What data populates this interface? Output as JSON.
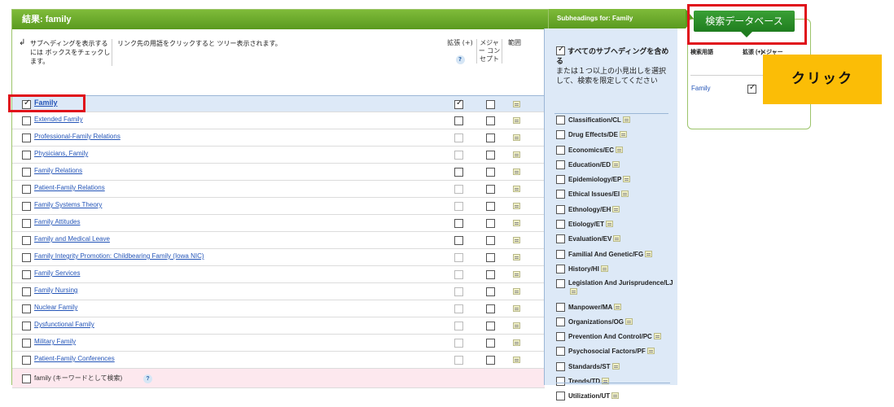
{
  "results": {
    "header": "結果: family",
    "instruction_col1": "サブヘディングを表示するには ボックスをチェックします。",
    "instruction_col2": "リンク先の用語をクリックすると ツリー表示されます。",
    "col_explode": "拡張 (+)",
    "col_major": "メジャー コンセプト",
    "col_scope": "範囲",
    "help_icon": "?",
    "rows": [
      {
        "label": "Family",
        "term_checked": true,
        "explode_checked": true,
        "major_checked": false,
        "explode_enabled": true
      },
      {
        "label": "Extended Family",
        "term_checked": false,
        "explode_checked": false,
        "major_checked": false,
        "explode_enabled": true
      },
      {
        "label": "Professional-Family Relations",
        "term_checked": false,
        "explode_checked": false,
        "major_checked": false,
        "explode_enabled": false
      },
      {
        "label": "Physicians, Family",
        "term_checked": false,
        "explode_checked": false,
        "major_checked": false,
        "explode_enabled": false
      },
      {
        "label": "Family Relations",
        "term_checked": false,
        "explode_checked": false,
        "major_checked": false,
        "explode_enabled": true
      },
      {
        "label": "Patient-Family Relations",
        "term_checked": false,
        "explode_checked": false,
        "major_checked": false,
        "explode_enabled": false
      },
      {
        "label": "Family Systems Theory",
        "term_checked": false,
        "explode_checked": false,
        "major_checked": false,
        "explode_enabled": false
      },
      {
        "label": "Family Attitudes",
        "term_checked": false,
        "explode_checked": false,
        "major_checked": false,
        "explode_enabled": true
      },
      {
        "label": "Family and Medical Leave",
        "term_checked": false,
        "explode_checked": false,
        "major_checked": false,
        "explode_enabled": true
      },
      {
        "label": "Family Integrity Promotion: Childbearing Family (Iowa NIC)",
        "term_checked": false,
        "explode_checked": false,
        "major_checked": false,
        "explode_enabled": false
      },
      {
        "label": "Family Services",
        "term_checked": false,
        "explode_checked": false,
        "major_checked": false,
        "explode_enabled": false
      },
      {
        "label": "Family Nursing",
        "term_checked": false,
        "explode_checked": false,
        "major_checked": false,
        "explode_enabled": false
      },
      {
        "label": "Nuclear Family",
        "term_checked": false,
        "explode_checked": false,
        "major_checked": false,
        "explode_enabled": false
      },
      {
        "label": "Dysfunctional Family",
        "term_checked": false,
        "explode_checked": false,
        "major_checked": false,
        "explode_enabled": false
      },
      {
        "label": "Military Family",
        "term_checked": false,
        "explode_checked": false,
        "major_checked": false,
        "explode_enabled": false
      },
      {
        "label": "Patient-Family Conferences",
        "term_checked": false,
        "explode_checked": false,
        "major_checked": false,
        "explode_enabled": false
      }
    ],
    "keyword_row": "family (キーワードとして検索)"
  },
  "subheadings": {
    "header": "Subheadings for: Family",
    "all_bold": "すべてのサブヘディングを含める",
    "all_rest": "または１つ以上の小見出しを選択して、検索を限定してください",
    "items": [
      "Classification/CL",
      "Drug Effects/DE",
      "Economics/EC",
      "Education/ED",
      "Epidemiology/EP",
      "Ethical Issues/EI",
      "Ethnology/EH",
      "Etiology/ET",
      "Evaluation/EV",
      "Familial And Genetic/FG",
      "History/HI",
      "Legislation And Jurisprudence/LJ",
      "Manpower/MA",
      "Organizations/OG",
      "Prevention And Control/PC",
      "Psychosocial Factors/PF",
      "Standards/ST",
      "Trends/TD",
      "Utilization/UT"
    ]
  },
  "database": {
    "button": "検索データベース",
    "col_term": "検索用語",
    "col_explode": "拡張 (+)",
    "col_major": "メジャー",
    "term": "Family"
  },
  "callout": "クリック"
}
